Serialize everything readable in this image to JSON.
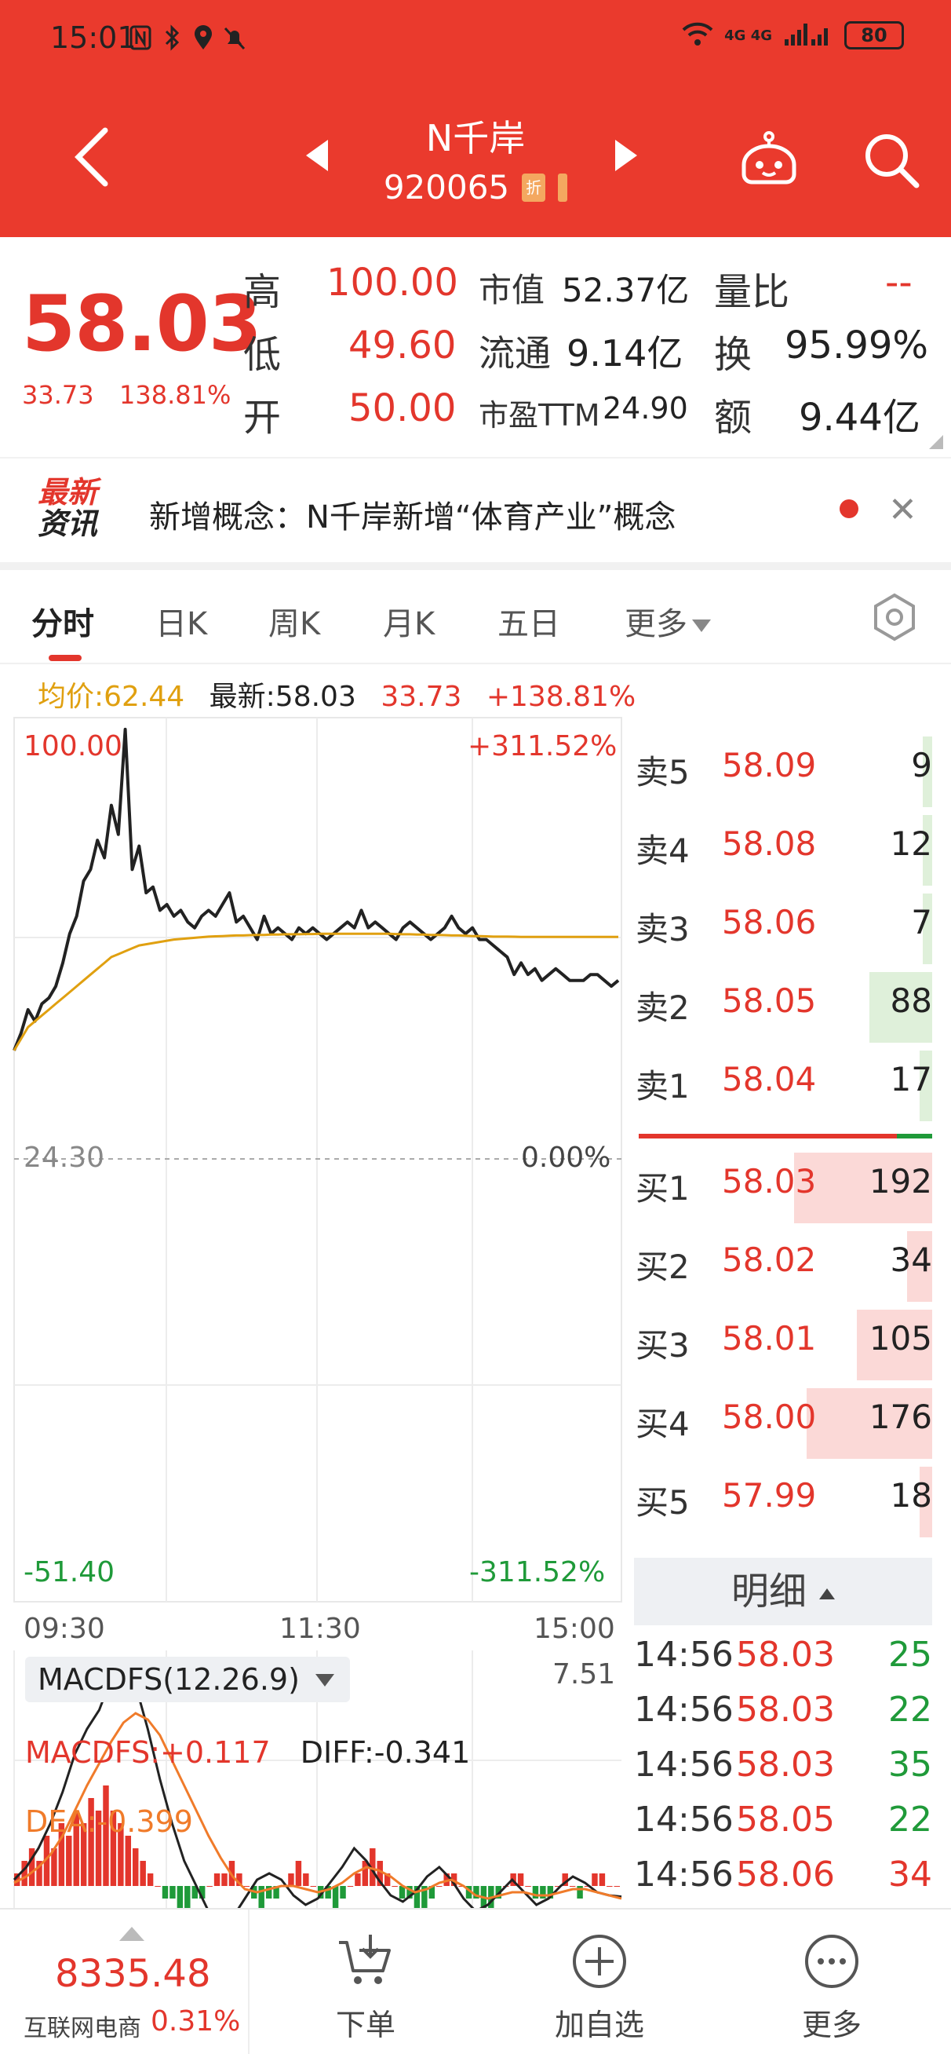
{
  "status_bar": {
    "time": "15:01",
    "network": "4G 4G",
    "battery": "80"
  },
  "header": {
    "stock_name": "N千岸",
    "stock_code": "920065",
    "tag": "折"
  },
  "quote": {
    "price": "58.03",
    "change": "33.73",
    "change_pct": "138.81%",
    "high_label": "高",
    "high": "100.00",
    "low_label": "低",
    "low": "49.60",
    "open_label": "开",
    "open": "50.00",
    "mcap_label": "市值",
    "mcap": "52.37亿",
    "float_label": "流通",
    "float": "9.14亿",
    "pe_label": "市盈TTM",
    "pe": "24.90",
    "vr_label": "量比",
    "vr": "--",
    "turnover_label": "换",
    "turnover": "95.99%",
    "amount_label": "额",
    "amount": "9.44亿"
  },
  "news": {
    "logo_line1": "最新",
    "logo_line2": "资讯",
    "text": "新增概念：N千岸新增“体育产业”概念"
  },
  "tabs": [
    "分时",
    "日K",
    "周K",
    "月K",
    "五日",
    "更多"
  ],
  "info": {
    "avg_label": "均价:62.44",
    "latest_label": "最新:58.03",
    "change": "33.73",
    "change_pct": "+138.81%"
  },
  "chart_labels": {
    "top_left": "100.00",
    "top_right": "+311.52%",
    "mid_left": "24.30",
    "mid_right": "0.00%",
    "bot_left": "-51.40",
    "bot_right": "-311.52%",
    "time_start": "09:30",
    "time_mid": "11:30",
    "time_end": "15:00"
  },
  "chart_data": {
    "type": "line",
    "x_ticks": [
      "09:30",
      "11:30",
      "15:00"
    ],
    "ylim": [
      -51.4,
      100
    ],
    "y_center": 24.3,
    "series": [
      {
        "name": "最新",
        "color": "#222222",
        "values": [
          43,
          46,
          50,
          48,
          51,
          52,
          54,
          58,
          63,
          66,
          72,
          74,
          79,
          76,
          85,
          80,
          98,
          74,
          78,
          70,
          71,
          67,
          68,
          66,
          67,
          65,
          64,
          66,
          67,
          66,
          68,
          70,
          65,
          66,
          64,
          62,
          66,
          63,
          64,
          63,
          62,
          64,
          63,
          64,
          63,
          62,
          63,
          64,
          65,
          64,
          67,
          64,
          65,
          64,
          63,
          62,
          64,
          65,
          64,
          63,
          62,
          63,
          64,
          66,
          64,
          63,
          64,
          62,
          62,
          61,
          60,
          59,
          56,
          58,
          56,
          57,
          55,
          56,
          57,
          56,
          55,
          55,
          55,
          56,
          56,
          55,
          54,
          55
        ]
      },
      {
        "name": "均价",
        "color": "#e0a010",
        "values": [
          43,
          45,
          47,
          48,
          49,
          50,
          51,
          52,
          53,
          54,
          55,
          56,
          57,
          58,
          59,
          59.5,
          60,
          60.5,
          61,
          61.2,
          61.4,
          61.6,
          61.8,
          62,
          62.1,
          62.2,
          62.3,
          62.4,
          62.5,
          62.55,
          62.6,
          62.65,
          62.7,
          62.7,
          62.75,
          62.8,
          62.8,
          62.85,
          62.85,
          62.9,
          62.9,
          62.9,
          62.95,
          62.95,
          63,
          63,
          63,
          63,
          63,
          63,
          63,
          63,
          63,
          63,
          63,
          62.95,
          62.9,
          62.9,
          62.85,
          62.85,
          62.8,
          62.8,
          62.75,
          62.7,
          62.7,
          62.65,
          62.6,
          62.6,
          62.55,
          62.5,
          62.5,
          62.5,
          62.48,
          62.46,
          62.45,
          62.45,
          62.44,
          62.44,
          62.44,
          62.44,
          62.44,
          62.44,
          62.44,
          62.44,
          62.44,
          62.44,
          62.44,
          62.44
        ]
      }
    ]
  },
  "macd": {
    "indicator": "MACDFS(12.26.9)",
    "max": "7.51",
    "macdfs": "MACDFS:+0.117",
    "diff": "DIFF:-0.341",
    "dea": "DEA:-0.399",
    "bars": [
      1,
      2,
      3,
      2,
      4,
      3,
      5,
      4,
      6,
      5,
      7,
      6,
      8,
      6,
      5,
      4,
      3,
      2,
      1,
      0,
      -1,
      -1,
      -2,
      -2,
      -1,
      -1,
      0,
      1,
      1,
      2,
      1,
      0,
      -1,
      -2,
      -1,
      -1,
      0,
      1,
      2,
      1,
      0,
      -1,
      -1,
      -2,
      -1,
      0,
      1,
      2,
      3,
      2,
      1,
      0,
      -1,
      -1,
      -2,
      -2,
      -1,
      0,
      1,
      1,
      0,
      -1,
      -1,
      -2,
      -2,
      -1,
      0,
      1,
      1,
      0,
      -1,
      -1,
      -1,
      0,
      1,
      0,
      -1,
      0,
      1,
      1,
      0,
      0
    ],
    "diff_line": [
      0.2,
      0.6,
      1.2,
      2.0,
      3.0,
      4.2,
      5.0,
      5.6,
      6.6,
      7.1,
      6.4,
      5.0,
      3.4,
      2.0,
      0.8,
      0.0,
      -0.8,
      -1.2,
      -1.0,
      -0.4,
      0.2,
      0.4,
      0.2,
      -0.3,
      -0.6,
      -0.4,
      0.1,
      0.6,
      1.2,
      0.8,
      0.2,
      -0.3,
      -0.5,
      -0.2,
      0.3,
      0.6,
      0.2,
      -0.4,
      -0.8,
      -0.6,
      -0.2,
      0.2,
      -0.2,
      -0.6,
      -0.4,
      0.0,
      0.3,
      0.1,
      -0.2,
      -0.3,
      -0.34
    ],
    "dea_line": [
      0.1,
      0.3,
      0.6,
      1.0,
      1.6,
      2.4,
      3.2,
      3.9,
      4.6,
      5.2,
      5.5,
      5.3,
      4.8,
      4.0,
      3.2,
      2.4,
      1.6,
      0.9,
      0.3,
      -0.1,
      -0.2,
      -0.1,
      0.0,
      0.0,
      -0.1,
      -0.2,
      -0.1,
      0.1,
      0.4,
      0.6,
      0.5,
      0.3,
      0.0,
      -0.2,
      -0.1,
      0.1,
      0.2,
      0.0,
      -0.3,
      -0.4,
      -0.3,
      -0.2,
      -0.2,
      -0.3,
      -0.3,
      -0.2,
      -0.1,
      -0.1,
      -0.2,
      -0.3,
      -0.4
    ]
  },
  "orderbook": {
    "asks": [
      {
        "label": "卖5",
        "price": "58.09",
        "qty": "9",
        "ratio": 0.02
      },
      {
        "label": "卖4",
        "price": "58.08",
        "qty": "12",
        "ratio": 0.03
      },
      {
        "label": "卖3",
        "price": "58.06",
        "qty": "7",
        "ratio": 0.02
      },
      {
        "label": "卖2",
        "price": "58.05",
        "qty": "88",
        "ratio": 0.2
      },
      {
        "label": "卖1",
        "price": "58.04",
        "qty": "17",
        "ratio": 0.04
      }
    ],
    "bids": [
      {
        "label": "买1",
        "price": "58.03",
        "qty": "192",
        "ratio": 0.44
      },
      {
        "label": "买2",
        "price": "58.02",
        "qty": "34",
        "ratio": 0.08
      },
      {
        "label": "买3",
        "price": "58.01",
        "qty": "105",
        "ratio": 0.24
      },
      {
        "label": "买4",
        "price": "58.00",
        "qty": "176",
        "ratio": 0.4
      },
      {
        "label": "买5",
        "price": "57.99",
        "qty": "18",
        "ratio": 0.04
      }
    ],
    "buy_ratio": 0.88
  },
  "detail": {
    "title": "明细",
    "trades": [
      {
        "time": "14:56",
        "price": "58.03",
        "vol": "25",
        "side": "sell"
      },
      {
        "time": "14:56",
        "price": "58.03",
        "vol": "22",
        "side": "sell"
      },
      {
        "time": "14:56",
        "price": "58.03",
        "vol": "35",
        "side": "sell"
      },
      {
        "time": "14:56",
        "price": "58.05",
        "vol": "22",
        "side": "sell"
      },
      {
        "time": "14:56",
        "price": "58.06",
        "vol": "34",
        "side": "buy"
      }
    ]
  },
  "bottom": {
    "index_value": "8335.48",
    "index_name": "互联网电商",
    "index_pct": "0.31%",
    "order_label": "下单",
    "watch_label": "加自选",
    "more_label": "更多"
  },
  "colors": {
    "red": "#e3362c",
    "green": "#1f9a39",
    "header": "#ea3a2d",
    "avg": "#e0a010"
  }
}
